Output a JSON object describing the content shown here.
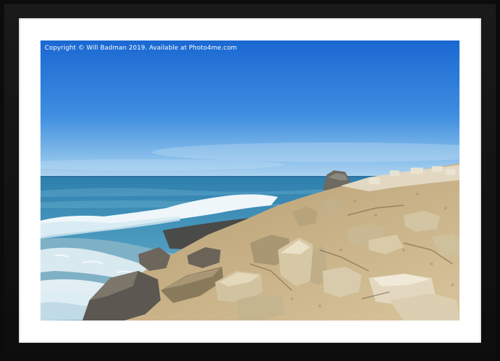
{
  "watermark": {
    "text": "Copyright  © Will Badman  2019. Available at Photo4me.com"
  },
  "colors": {
    "frame": "#0c0c0c",
    "mount": "#ffffff",
    "sky_top": "#1f6fd6",
    "sky_horizon": "#9cc8ea",
    "sea": "#3a8fb8",
    "rock": "#c9b58c"
  }
}
